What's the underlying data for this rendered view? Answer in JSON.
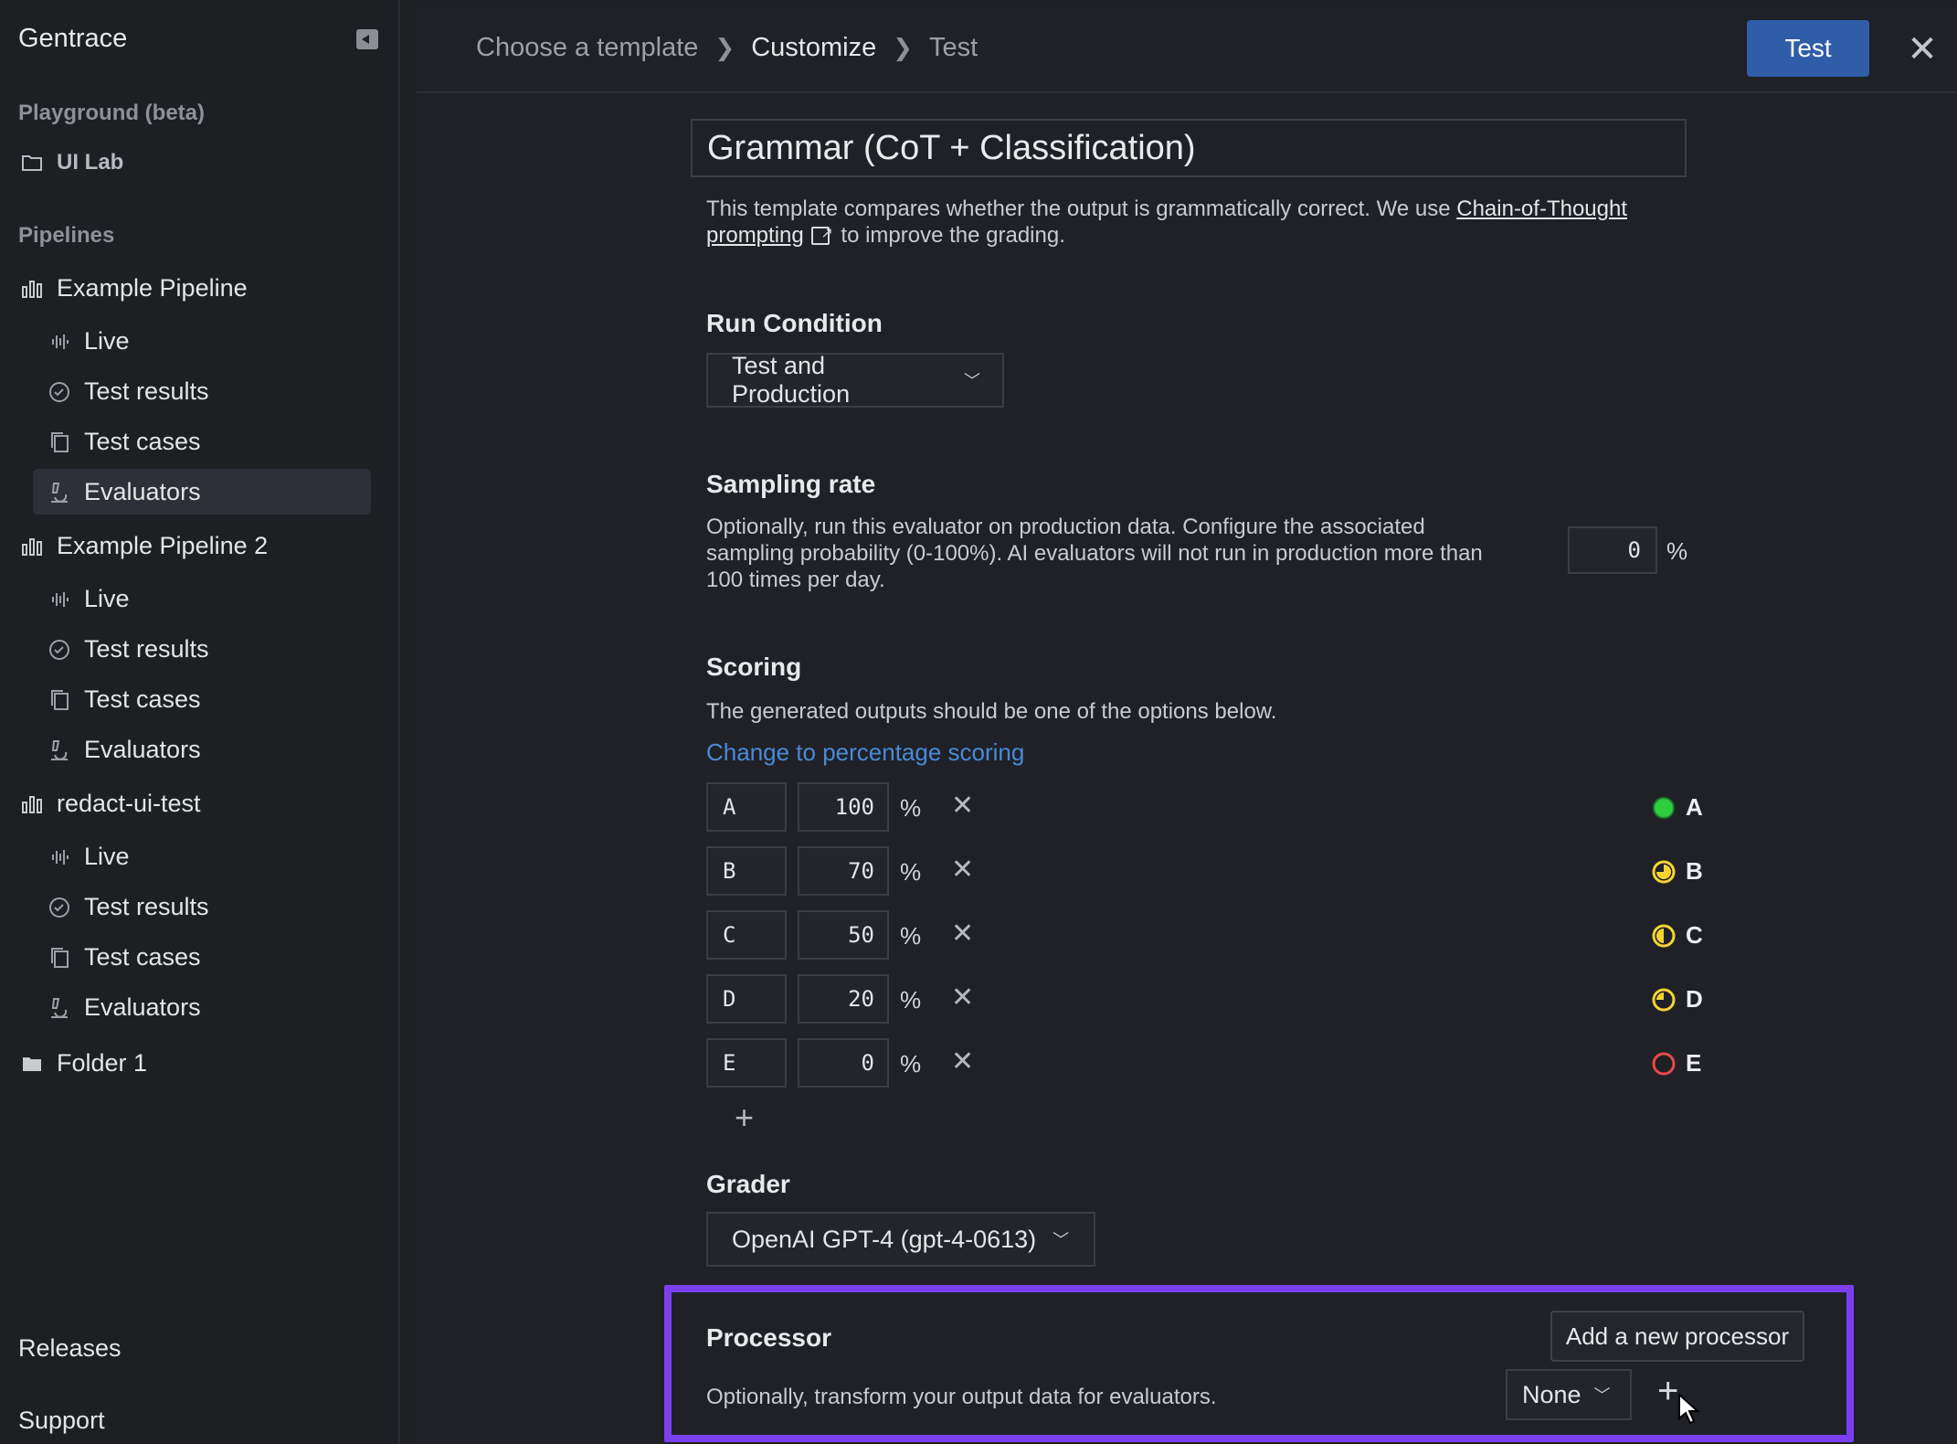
{
  "app": {
    "title": "Gentrace"
  },
  "sidebar": {
    "playground_label": "Playground (beta)",
    "playground_item": "UI Lab",
    "pipelines_label": "Pipelines",
    "pipelines": [
      {
        "name": "Example Pipeline",
        "items": [
          "Live",
          "Test results",
          "Test cases",
          "Evaluators"
        ]
      },
      {
        "name": "Example Pipeline 2",
        "items": [
          "Live",
          "Test results",
          "Test cases",
          "Evaluators"
        ]
      },
      {
        "name": "redact-ui-test",
        "items": [
          "Live",
          "Test results",
          "Test cases",
          "Evaluators"
        ]
      }
    ],
    "folder": "Folder 1",
    "footer": [
      "Releases",
      "Support"
    ]
  },
  "breadcrumb": [
    "Choose a template",
    "Customize",
    "Test"
  ],
  "actions": {
    "test_label": "Test",
    "close_glyph": "✕"
  },
  "evaluator": {
    "title": "Grammar (CoT + Classification)",
    "desc_pre": "This template compares whether the output is grammatically correct. We use ",
    "desc_link": "Chain-of-Thought prompting",
    "desc_post": " to improve the grading.",
    "run_condition": {
      "label": "Run Condition",
      "value": "Test and Production"
    },
    "sampling": {
      "label": "Sampling rate",
      "description": "Optionally, run this evaluator on production data. Configure the associated sampling probability (0-100%). AI evaluators will not run in production more than 100 times per day.",
      "value": "0",
      "unit": "%"
    },
    "scoring": {
      "label": "Scoring",
      "description": "The generated outputs should be one of the options below.",
      "change_link": "Change to percentage scoring",
      "unit": "%",
      "rows": [
        {
          "letter": "A",
          "value": "100",
          "color": "#2ecc40"
        },
        {
          "letter": "B",
          "value": "70",
          "color": "#f5d431"
        },
        {
          "letter": "C",
          "value": "50",
          "color": "#f5d431"
        },
        {
          "letter": "D",
          "value": "20",
          "color": "#f5d431"
        },
        {
          "letter": "E",
          "value": "0",
          "color": "#e5484d"
        }
      ]
    },
    "grader": {
      "label": "Grader",
      "value": "OpenAI GPT-4 (gpt-4-0613)"
    },
    "processor": {
      "label": "Processor",
      "description": "Optionally, transform your output data for evaluators.",
      "add_button": "Add a new processor",
      "value": "None"
    }
  }
}
